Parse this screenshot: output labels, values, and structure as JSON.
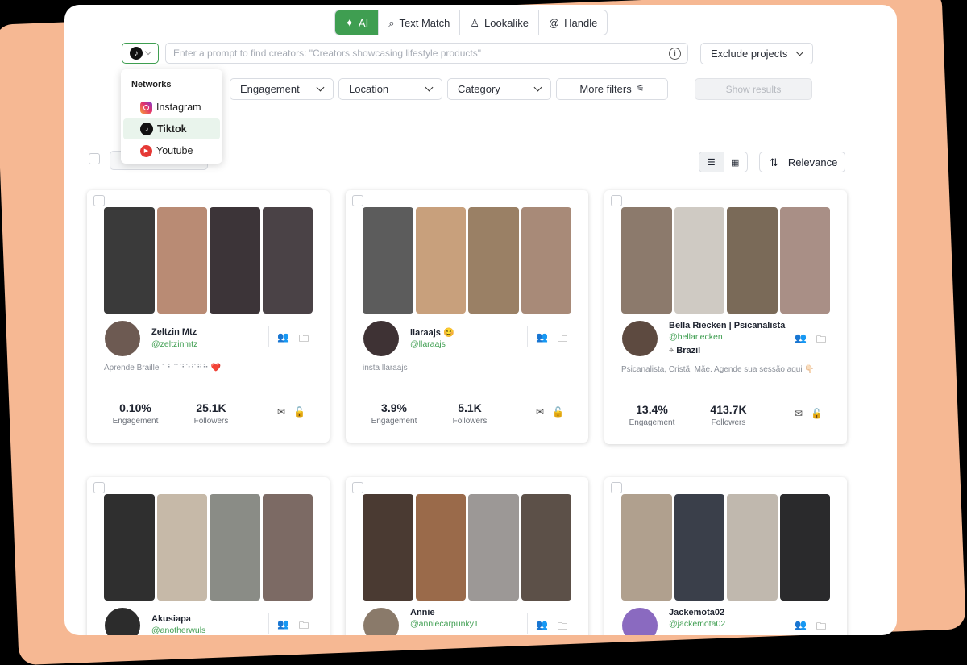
{
  "search_modes": [
    {
      "label": "AI",
      "icon": "sparkle-icon",
      "active": true
    },
    {
      "label": "Text Match",
      "icon": "search-icon"
    },
    {
      "label": "Lookalike",
      "icon": "person-icon"
    },
    {
      "label": "Handle",
      "icon": "at-icon"
    }
  ],
  "prompt": {
    "placeholder": "Enter a prompt to find creators: \"Creators showcasing lifestyle products\""
  },
  "exclude_projects": "Exclude projects",
  "filters": {
    "engagement": "Engagement",
    "location": "Location",
    "category": "Category",
    "more": "More filters",
    "show_results": "Show results"
  },
  "networks_menu": {
    "title": "Networks",
    "items": [
      {
        "label": "Instagram",
        "icon": "instagram-icon"
      },
      {
        "label": "Tiktok",
        "icon": "tiktok-icon",
        "selected": true
      },
      {
        "label": "Youtube",
        "icon": "youtube-icon"
      }
    ]
  },
  "sort": {
    "label": "Relevance"
  },
  "colors": {
    "accent": "#3f9e51",
    "background_peach": "#F6B893"
  },
  "creators": [
    {
      "name": "Zeltzin Mtz",
      "handle": "@zeltzinmtz",
      "location": "",
      "bio": "Aprende Braille ⠁⠃⠉⠙⠑⠋⠛⠓ ❤️",
      "engagement": "0.10%",
      "followers": "25.1K",
      "engagement_label": "Engagement",
      "followers_label": "Followers",
      "thumbs": [
        "#3a3a3a",
        "#b98b74",
        "#3c3438",
        "#4a4246"
      ],
      "avatar": "#6d5a52"
    },
    {
      "name": "llaraajs 😊",
      "handle": "@llaraajs",
      "location": "",
      "bio": "insta llaraajs",
      "engagement": "3.9%",
      "followers": "5.1K",
      "engagement_label": "Engagement",
      "followers_label": "Followers",
      "thumbs": [
        "#5c5c5c",
        "#c8a07c",
        "#9a8065",
        "#a88a78"
      ],
      "avatar": "#3e3234"
    },
    {
      "name": "Bella Riecken | Psicanalista",
      "handle": "@bellariecken",
      "location": "Brazil",
      "bio": "Psicanalista, Cristã, Mãe. Agende sua sessão aqui 👇🏻",
      "engagement": "13.4%",
      "followers": "413.7K",
      "engagement_label": "Engagement",
      "followers_label": "Followers",
      "thumbs": [
        "#8c7a6c",
        "#cfcac3",
        "#7a6a58",
        "#a98f86"
      ],
      "avatar": "#5d4a40"
    },
    {
      "name": "Akusiapa",
      "handle": "@anotherwuls",
      "location": "",
      "bio": "",
      "engagement": "",
      "followers": "",
      "engagement_label": "",
      "followers_label": "",
      "thumbs": [
        "#2f2f2f",
        "#c6b9a8",
        "#8a8c86",
        "#7c6a64"
      ],
      "avatar": "#2c2c2c"
    },
    {
      "name": "Annie",
      "handle": "@anniecarpunky1",
      "location": "",
      "bio": "",
      "engagement": "",
      "followers": "",
      "engagement_label": "",
      "followers_label": "",
      "thumbs": [
        "#4a3a32",
        "#9a6a4a",
        "#9c9896",
        "#5c5048"
      ],
      "avatar": "#8a7a6a"
    },
    {
      "name": "Jackemota02",
      "handle": "@jackemota02",
      "location": "",
      "bio": "",
      "engagement": "",
      "followers": "",
      "engagement_label": "",
      "followers_label": "",
      "thumbs": [
        "#b0a08e",
        "#3a3f4a",
        "#c0b8ae",
        "#2a2a2c"
      ],
      "avatar": "#8a6ac0"
    }
  ]
}
